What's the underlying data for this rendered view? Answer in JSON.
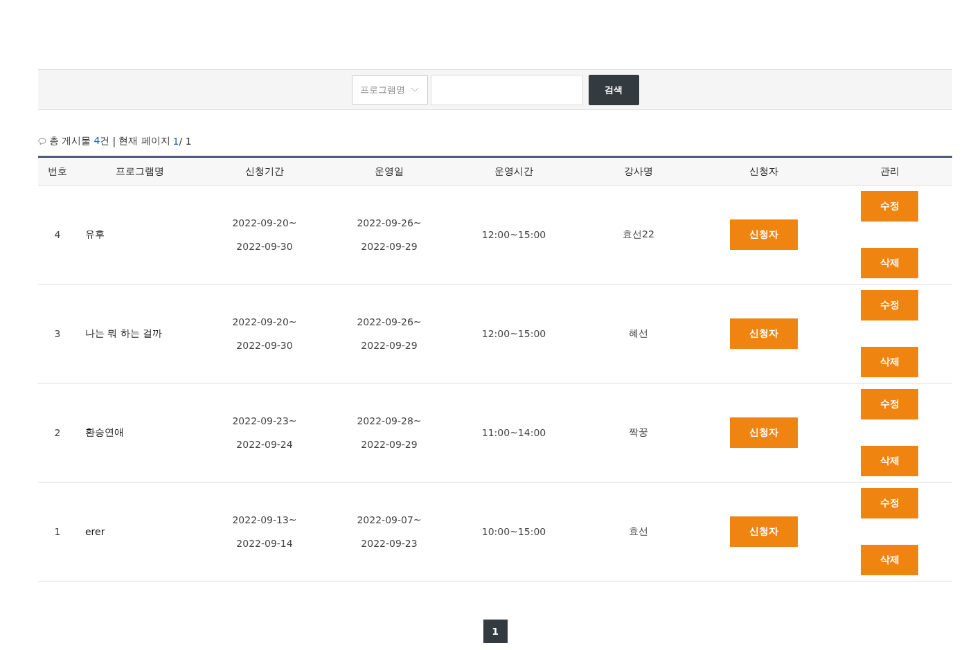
{
  "search": {
    "select": "프로그램명",
    "button": "검색"
  },
  "summary": {
    "total_label": "총 게시물",
    "total_count": "4",
    "total_unit": "건",
    "separator": "|",
    "page_label": "현재 페이지",
    "current_page": "1",
    "total_pages": "/ 1"
  },
  "table": {
    "columns": [
      "번호",
      "프로그램명",
      "신청기간",
      "운영일",
      "운영시간",
      "강사명",
      "신청자",
      "관리"
    ],
    "rows": [
      {
        "no": "4",
        "program": "유후",
        "apply_start": "2022-09-20~",
        "apply_end": "2022-09-30",
        "run_start": "2022-09-26~",
        "run_end": "2022-09-29",
        "time": "12:00~15:00",
        "instructor": "효선22",
        "applicants": "신청자",
        "edit": "수정",
        "delete": "삭제"
      },
      {
        "no": "3",
        "program": "나는 뭐 하는 걸까",
        "apply_start": "2022-09-20~",
        "apply_end": "2022-09-30",
        "run_start": "2022-09-26~",
        "run_end": "2022-09-29",
        "time": "12:00~15:00",
        "instructor": "혜선",
        "applicants": "신청자",
        "edit": "수정",
        "delete": "삭제"
      },
      {
        "no": "2",
        "program": "환승연애",
        "apply_start": "2022-09-23~",
        "apply_end": "2022-09-24",
        "run_start": "2022-09-28~",
        "run_end": "2022-09-29",
        "time": "11:00~14:00",
        "instructor": "짝꿍",
        "applicants": "신청자",
        "edit": "수정",
        "delete": "삭제"
      },
      {
        "no": "1",
        "program": "erer",
        "apply_start": "2022-09-13~",
        "apply_end": "2022-09-14",
        "run_start": "2022-09-07~",
        "run_end": "2022-09-23",
        "time": "10:00~15:00",
        "instructor": "효선",
        "applicants": "신청자",
        "edit": "수정",
        "delete": "삭제"
      }
    ]
  },
  "pagination": [
    {
      "label": "1",
      "selected": true
    }
  ]
}
